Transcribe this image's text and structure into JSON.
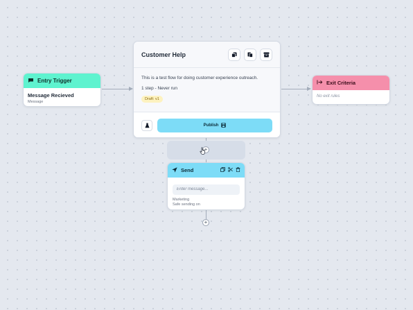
{
  "entry_trigger": {
    "title": "Entry Trigger",
    "color": "#5ef3cf",
    "item_title": "Message Recieved",
    "item_sub": "Message",
    "icon": "message-icon"
  },
  "flow": {
    "title": "Customer Help",
    "description": "This is a test flow for doing customer experience outreach.",
    "meta": "1 step - Never run",
    "badge": "Draft: v1",
    "publish_label": "Publish",
    "header_icons": [
      "copy-icon",
      "duplicate-icon",
      "archive-icon"
    ],
    "test_icon": "flask-icon",
    "publish_icon": "save-icon"
  },
  "exit_criteria": {
    "title": "Exit Criteria",
    "color": "#f58fab",
    "empty_text": "No exit rules",
    "icon": "exit-arrow-icon"
  },
  "send_step": {
    "title": "Send",
    "color": "#7ddcf7",
    "placeholder": "Enter message...",
    "info_lines": [
      "Marketing",
      "Safe sending on"
    ],
    "tool_icons": [
      "copy-icon",
      "scissors-icon",
      "trash-icon"
    ],
    "icon": "paper-plane-icon"
  },
  "add_step": {
    "symbol": "+"
  }
}
